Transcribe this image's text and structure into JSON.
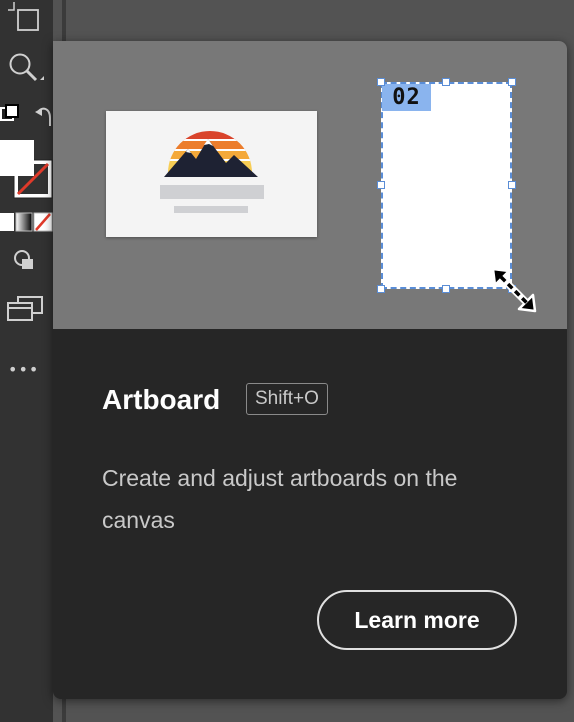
{
  "toolbar": {
    "tools": [
      {
        "name": "artboard-tool-icon"
      },
      {
        "name": "zoom-tool-icon"
      },
      {
        "name": "fill-stroke-icon"
      },
      {
        "name": "swap-fill-stroke-icon"
      },
      {
        "name": "color-mode-icon"
      },
      {
        "name": "draw-mode-icon"
      },
      {
        "name": "screen-mode-icon"
      },
      {
        "name": "more-tools-icon"
      }
    ],
    "more_label": "•••"
  },
  "tooltip": {
    "preview": {
      "artboard_number": "02",
      "logo_colors": [
        "#d9442b",
        "#ec7d2c",
        "#f4a93a",
        "#f7cd55"
      ]
    },
    "title": "Artboard",
    "shortcut": "Shift+O",
    "description": "Create and adjust artboards on the canvas",
    "learn_more_label": "Learn more"
  },
  "colors": {
    "card_bg": "#262626",
    "preview_bg": "#787878",
    "selection_blue": "#5a8dd6"
  }
}
